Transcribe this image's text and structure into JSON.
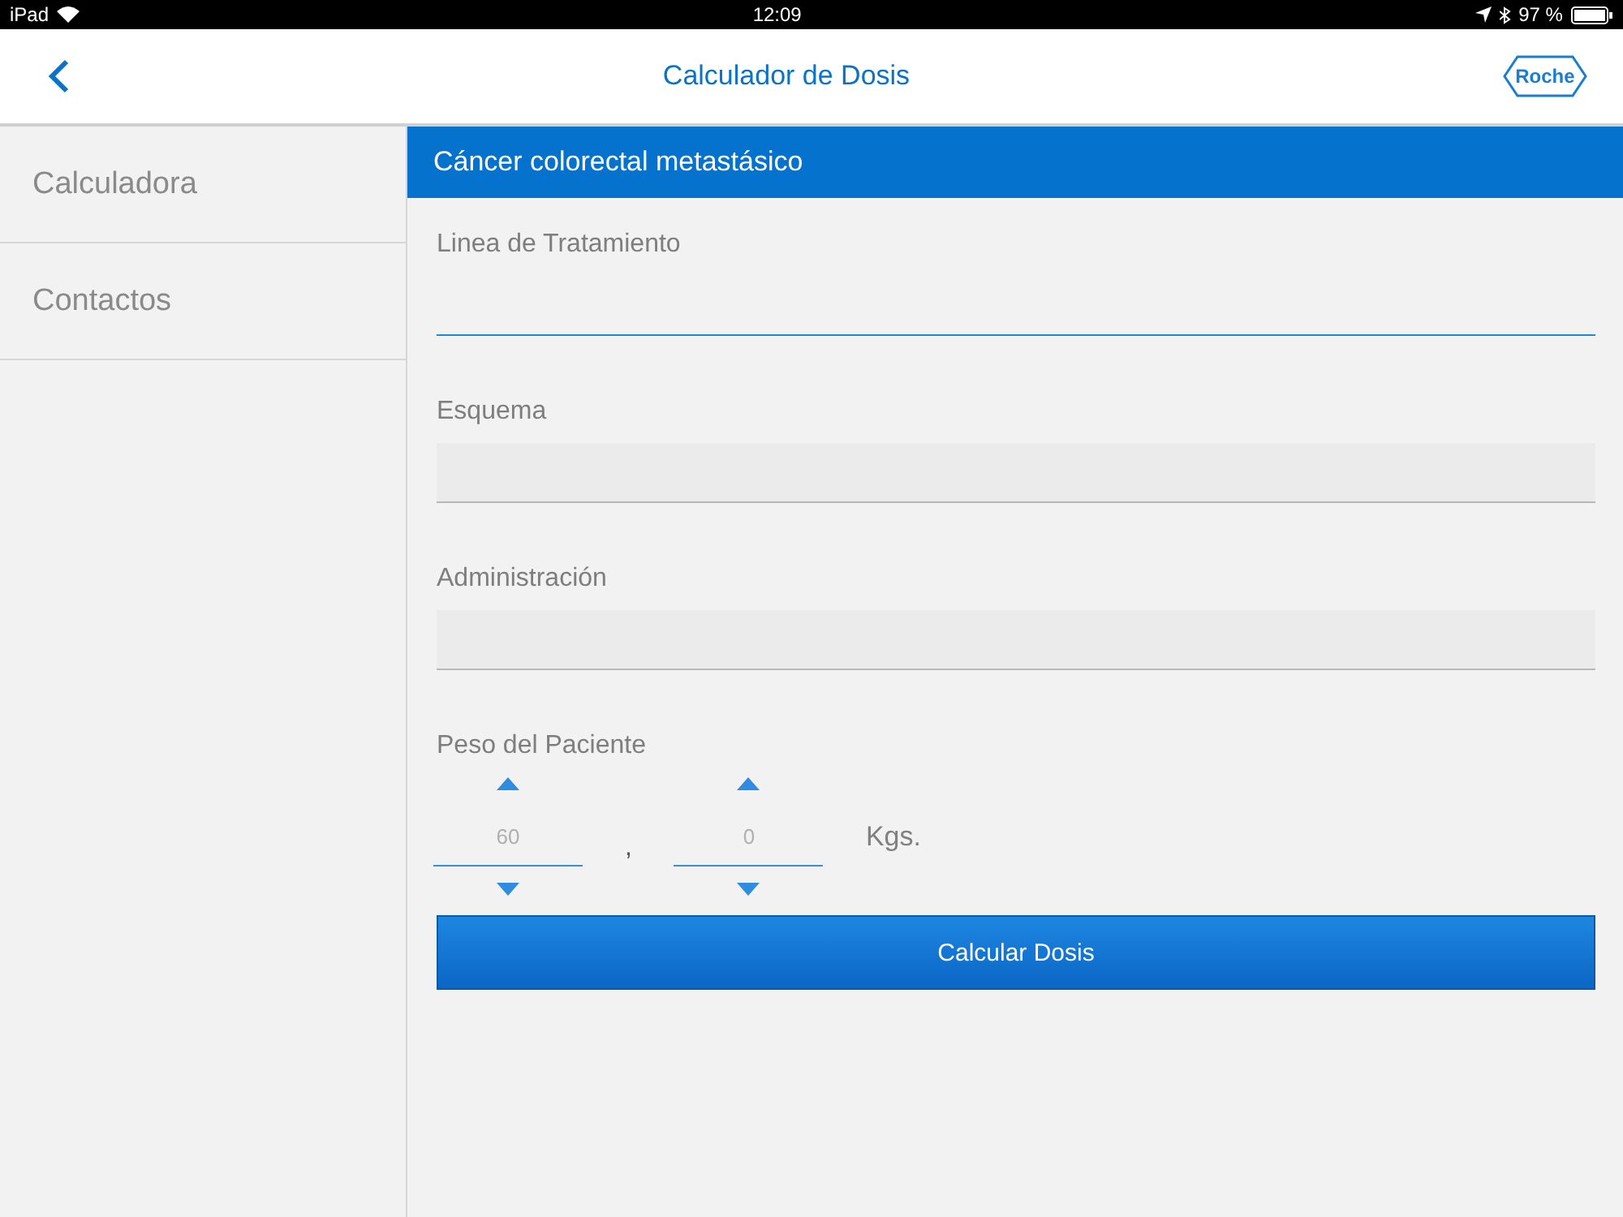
{
  "status_bar": {
    "device": "iPad",
    "time": "12:09",
    "battery": "97 %"
  },
  "nav_bar": {
    "title": "Calculador de Dosis",
    "logo": "Roche"
  },
  "sidebar": {
    "items": [
      {
        "label": "Calculadora",
        "selected": false
      },
      {
        "label": "Contactos",
        "selected": false
      }
    ]
  },
  "section": {
    "title": "Cáncer colorectal metastásico"
  },
  "fields": [
    {
      "label": "Linea de Tratamiento",
      "disabled": false
    },
    {
      "label": "Esquema",
      "disabled": true
    },
    {
      "label": "Administración",
      "disabled": true
    }
  ],
  "weight": {
    "label": "Peso del Paciente",
    "integer": "60",
    "separator": ",",
    "decimal": "0",
    "unit": "Kgs."
  },
  "button": {
    "label": "Calcular Dosis"
  }
}
